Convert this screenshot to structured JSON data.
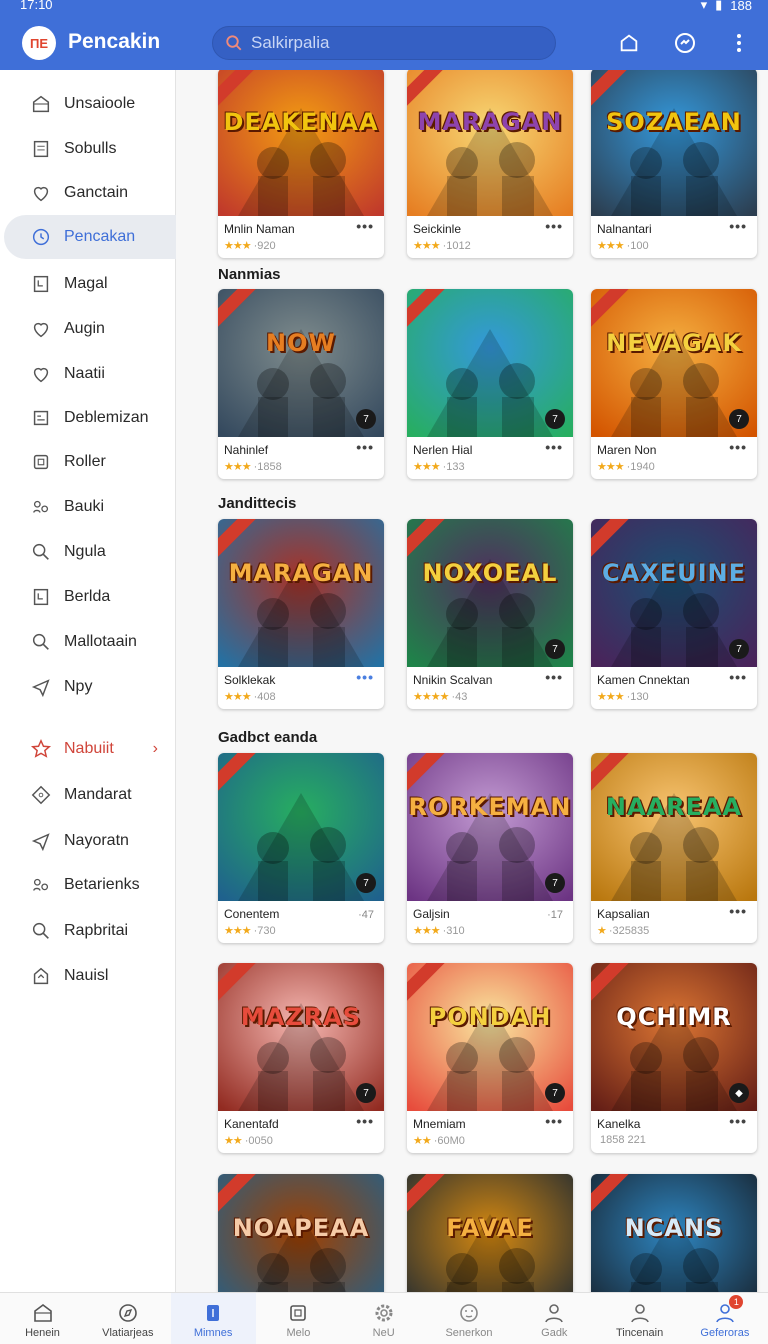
{
  "status_bar": {
    "time": "17:10",
    "battery": "188"
  },
  "app_bar": {
    "logo_text": "ΠΕ",
    "title": "Pencakin",
    "search_value": "",
    "search_placeholder": "Salkirpalia",
    "accent": "#3f6fd8"
  },
  "sidebar": {
    "items": [
      {
        "label": "Unsaioole",
        "icon": "home-icon"
      },
      {
        "label": "Sobulls",
        "icon": "list-icon"
      },
      {
        "label": "Ganctain",
        "icon": "heart-icon"
      },
      {
        "label": "Pencakan",
        "icon": "clock-icon",
        "active": true
      },
      {
        "label": "Magal",
        "icon": "book-icon"
      },
      {
        "label": "Augin",
        "icon": "heart-icon"
      },
      {
        "label": "Naatii",
        "icon": "heart-icon"
      },
      {
        "label": "Deblemizan",
        "icon": "image-icon"
      },
      {
        "label": "Roller",
        "icon": "frame-icon"
      },
      {
        "label": "Bauki",
        "icon": "people-icon"
      },
      {
        "label": "Ngula",
        "icon": "search-icon"
      },
      {
        "label": "Berlda",
        "icon": "book-icon"
      },
      {
        "label": "Mallotaain",
        "icon": "search-icon"
      },
      {
        "label": "Npy",
        "icon": "plane-icon"
      },
      {
        "label": "Nabuiit",
        "icon": "star-icon",
        "featured": true
      },
      {
        "label": "Mandarat",
        "icon": "tag-icon"
      },
      {
        "label": "Nayoratn",
        "icon": "plane-icon"
      },
      {
        "label": "Betarienks",
        "icon": "people-icon"
      },
      {
        "label": "Rapbritai",
        "icon": "search-icon"
      },
      {
        "label": "Nauisl",
        "icon": "house-outline-icon"
      }
    ]
  },
  "sections": [
    {
      "title": ""
    },
    {
      "title": "Nanmias"
    },
    {
      "title": "Jandittecis"
    },
    {
      "title": "Gadbct eanda"
    },
    {
      "title": ""
    },
    {
      "title": ""
    }
  ],
  "cards": [
    {
      "name": "Mnlin Naman",
      "stars": "★★★",
      "meta": "·920",
      "logo": "DEAKENAA",
      "c1": "#c0392b",
      "c2": "#f39c12",
      "txt": "#f1c40f"
    },
    {
      "name": "Seickinle",
      "stars": "★★★",
      "meta": "·1012",
      "logo": "MARAGAN",
      "c1": "#e67e22",
      "c2": "#f7d774",
      "txt": "#8e44ad"
    },
    {
      "name": "Nalnantari",
      "stars": "★★★",
      "meta": "·100",
      "logo": "SOZAEAN",
      "c1": "#2c3e50",
      "c2": "#3498db",
      "txt": "#f1c40f"
    },
    {
      "name": "Nahinlef",
      "stars": "★★★",
      "meta": "·1858",
      "logo": "NOW",
      "c1": "#34495e",
      "c2": "#7f8c8d",
      "txt": "#e67e22",
      "badge": "7"
    },
    {
      "name": "Nerlen Hial",
      "stars": "★★★",
      "meta": "·133",
      "logo": "",
      "c1": "#27ae60",
      "c2": "#3498db",
      "txt": "#ffffff",
      "badge": "7"
    },
    {
      "name": "Maren Non",
      "stars": "★★★",
      "meta": "·1940",
      "logo": "NEVAGAK",
      "c1": "#d35400",
      "c2": "#f5b041",
      "txt": "#f4d03f",
      "badge": "7"
    },
    {
      "name": "Solklekak",
      "stars": "★★★",
      "meta": "·408",
      "logo": "MARAGAN",
      "c1": "#2471a3",
      "c2": "#a93226",
      "txt": "#f5b041",
      "more_blue": true
    },
    {
      "name": "Nnikin Scalvan",
      "stars": "★★★★",
      "meta": "·43",
      "logo": "NOXOEAL",
      "c1": "#1e8449",
      "c2": "#512e5f",
      "txt": "#f4d03f",
      "badge": "7"
    },
    {
      "name": "Kamen Cnnektan",
      "stars": "★★★",
      "meta": "·130",
      "logo": "CAXEUINE",
      "c1": "#4a235a",
      "c2": "#1b4f72",
      "txt": "#5dade2",
      "badge": "7"
    },
    {
      "name": "Conentem",
      "stars": "★★★",
      "meta": "·730",
      "logo": "",
      "c1": "#1f618d",
      "c2": "#27ae60",
      "txt": "#ffffff",
      "count": "·47",
      "badge": "7"
    },
    {
      "name": "Galjsin",
      "stars": "★★★",
      "meta": "·310",
      "logo": "RORKEMAN",
      "c1": "#6c3483",
      "c2": "#c39bd3",
      "txt": "#f5b041",
      "count": "·17",
      "badge": "7"
    },
    {
      "name": "Kapsalian",
      "stars": "★",
      "meta": "·325835",
      "logo": "NAAREAA",
      "c1": "#b9770e",
      "c2": "#f8c471",
      "txt": "#27ae60"
    },
    {
      "name": "Kanentafd",
      "stars": "★★",
      "meta": "·0050",
      "logo": "MAZRAS",
      "c1": "#922b21",
      "c2": "#f5b7b1",
      "txt": "#e74c3c",
      "badge": "7"
    },
    {
      "name": "Mnemiam",
      "stars": "★★",
      "meta": "·60M0",
      "logo": "PONDAH",
      "c1": "#e74c3c",
      "c2": "#f9e79f",
      "txt": "#f4d03f",
      "badge": "7"
    },
    {
      "name": "Kanelka",
      "stars": "",
      "meta": "1858 221",
      "logo": "QCHIMR",
      "c1": "#641e16",
      "c2": "#dc7633",
      "txt": "#ffffff",
      "badge": "◆"
    },
    {
      "name": "",
      "stars": "",
      "meta": "",
      "logo": "NOAPEAA",
      "c1": "#21618c",
      "c2": "#a04000",
      "txt": "#f5cba7"
    },
    {
      "name": "",
      "stars": "",
      "meta": "",
      "logo": "FAVAE",
      "c1": "#1c2833",
      "c2": "#d68910",
      "txt": "#f5b041"
    },
    {
      "name": "",
      "stars": "",
      "meta": "",
      "logo": "NCANS",
      "c1": "#17202a",
      "c2": "#2e86c1",
      "txt": "#d6eaf8"
    }
  ],
  "bottom_nav": [
    {
      "label": "Henein",
      "icon": "home-icon"
    },
    {
      "label": "Vlatiarjeas",
      "icon": "compass-icon"
    },
    {
      "label": "Mimnes",
      "icon": "grid-icon",
      "active": true
    },
    {
      "label": "Melo",
      "icon": "frame-icon",
      "grey": true
    },
    {
      "label": "NeU",
      "icon": "settings-icon",
      "grey": true
    },
    {
      "label": "Senerkon",
      "icon": "face-icon",
      "grey": true
    },
    {
      "label": "Gadk",
      "icon": "person-icon",
      "grey": true
    },
    {
      "label": "Tincenain",
      "icon": "person-icon"
    },
    {
      "label": "Geferoras",
      "icon": "person-icon",
      "accent": true,
      "badge": "1"
    }
  ]
}
